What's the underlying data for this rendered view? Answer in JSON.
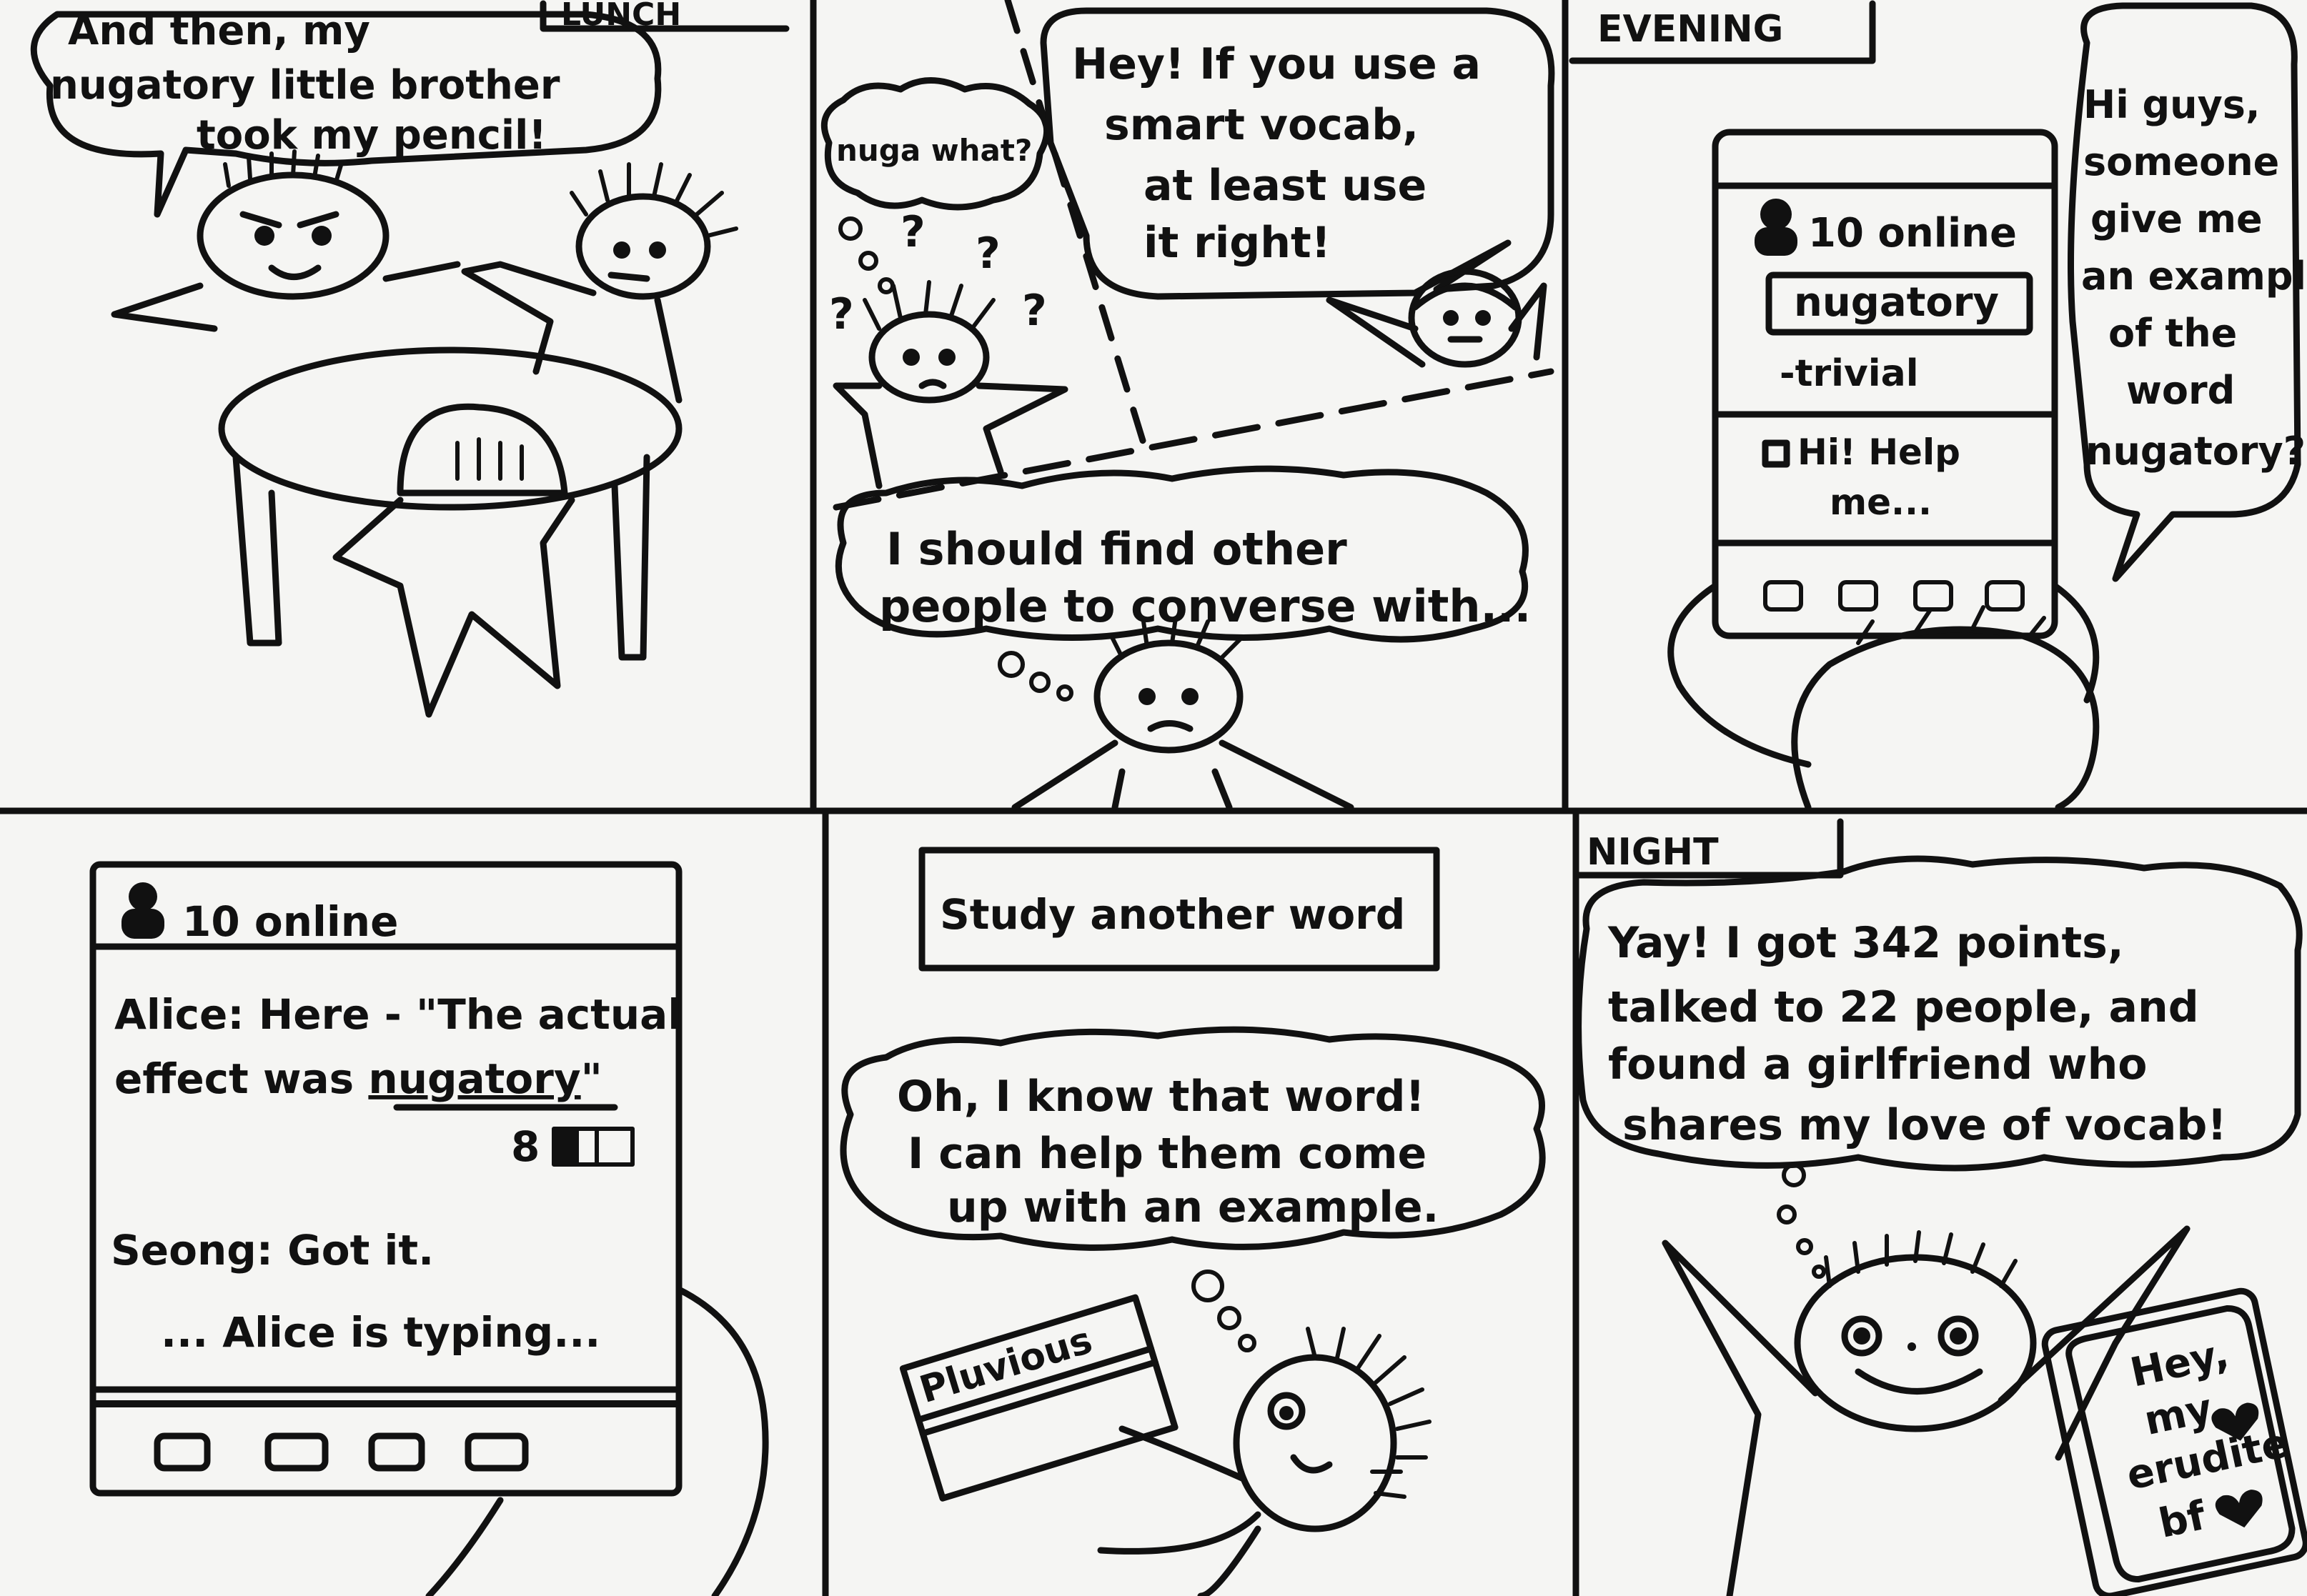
{
  "panels": {
    "p1": {
      "caption": "LUNCH",
      "speech": [
        "And then, my",
        "nugatory little brother",
        "took my pencil!"
      ]
    },
    "p2": {
      "thought_small": "nuga what?",
      "speech": [
        "Hey! If you use a",
        "smart vocab,",
        "at least use",
        "it right!"
      ],
      "thought": [
        "I should find other",
        "people to converse with..."
      ],
      "question_mark": "?"
    },
    "p3": {
      "caption": "EVENING",
      "phone_online": "10 online",
      "phone_word": "nugatory",
      "phone_definition": "-trivial",
      "phone_message": [
        "Hi! Help",
        "me..."
      ],
      "speech": [
        "Hi guys,",
        "someone",
        "give me",
        "an example",
        "of the",
        "word",
        "nugatory?"
      ]
    },
    "p4": {
      "phone_online": "10 online",
      "chat_line1": "Alice: Here - \"The actual",
      "chat_line2_prefix": "effect was ",
      "chat_line2_word": "nugatory",
      "chat_line2_suffix": "\"",
      "count": "8",
      "chat_line3": "Seong: Got it.",
      "chat_typing": "... Alice is typing..."
    },
    "p5": {
      "caption": "Study another word",
      "thought": [
        "Oh, I know that word!",
        "I can help them come",
        "up with an example."
      ],
      "card_word": "Pluvious"
    },
    "p6": {
      "caption": "NIGHT",
      "thought": [
        "Yay! I got 342 points,",
        "talked to 22 people, and",
        "found a girlfriend who",
        "shares my love of vocab!"
      ],
      "phone_message": [
        "Hey,",
        "my",
        "erudite",
        "bf"
      ]
    }
  },
  "colors": {
    "ink": "#111111",
    "paper": "#f5f5f3"
  }
}
